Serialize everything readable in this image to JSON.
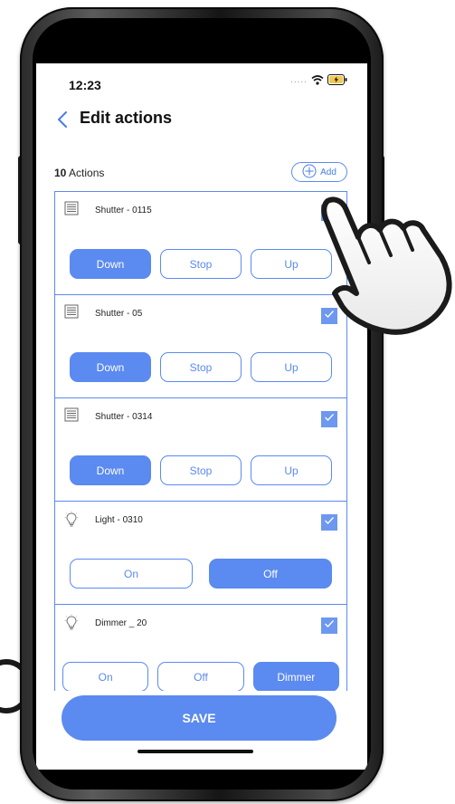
{
  "status_bar": {
    "time": "12:23",
    "signal": "....."
  },
  "header": {
    "title": "Edit actions"
  },
  "toolbar": {
    "count_number": "10",
    "count_label": "Actions",
    "add_label": "Add"
  },
  "items": [
    {
      "name": "Shutter - 0115",
      "icon": "shutter-icon",
      "checked": true,
      "buttons": [
        {
          "label": "Down",
          "selected": true
        },
        {
          "label": "Stop",
          "selected": false
        },
        {
          "label": "Up",
          "selected": false
        }
      ]
    },
    {
      "name": "Shutter - 05",
      "icon": "shutter-icon",
      "checked": true,
      "buttons": [
        {
          "label": "Down",
          "selected": true
        },
        {
          "label": "Stop",
          "selected": false
        },
        {
          "label": "Up",
          "selected": false
        }
      ]
    },
    {
      "name": "Shutter - 0314",
      "icon": "shutter-icon",
      "checked": true,
      "buttons": [
        {
          "label": "Down",
          "selected": true
        },
        {
          "label": "Stop",
          "selected": false
        },
        {
          "label": "Up",
          "selected": false
        }
      ]
    },
    {
      "name": "Light - 0310",
      "icon": "lightbulb-icon",
      "checked": true,
      "buttons": [
        {
          "label": "On",
          "selected": false
        },
        {
          "label": "Off",
          "selected": true
        }
      ]
    },
    {
      "name": "Dimmer _ 20",
      "icon": "lightbulb-icon",
      "checked": true,
      "buttons": [
        {
          "label": "On",
          "selected": false
        },
        {
          "label": "Off",
          "selected": false
        },
        {
          "label": "Dimmer",
          "selected": true
        }
      ]
    }
  ],
  "footer": {
    "save_label": "SAVE"
  },
  "colors": {
    "accent": "#5b8af0",
    "checkbox": "#6d98ef",
    "text": "#222222"
  }
}
